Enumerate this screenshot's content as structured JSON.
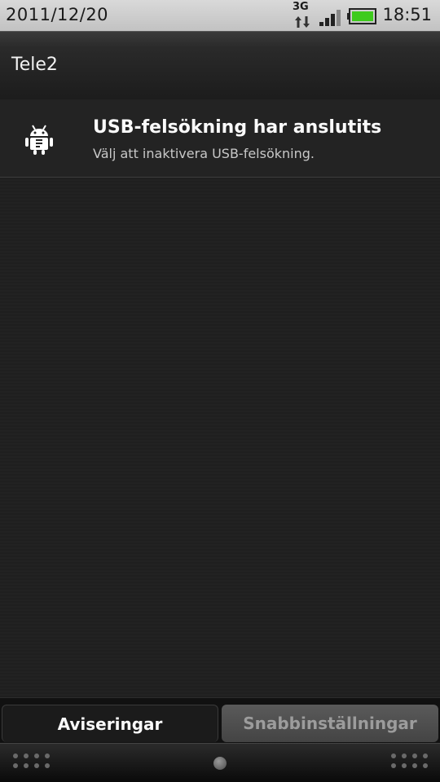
{
  "status_bar": {
    "date": "2011/12/20",
    "network_type": "3G",
    "time": "18:51",
    "signal_icon": "signal-bars-icon",
    "battery_icon": "battery-icon",
    "battery_color": "#3ecb1d"
  },
  "header": {
    "carrier": "Tele2"
  },
  "notifications": [
    {
      "icon": "android-debug-icon",
      "title": "USB-felsökning har anslutits",
      "subtitle": "Välj att inaktivera USB-felsökning."
    }
  ],
  "tabs": [
    {
      "label": "Aviseringar",
      "active": true
    },
    {
      "label": "Snabbinställningar",
      "active": false
    }
  ]
}
